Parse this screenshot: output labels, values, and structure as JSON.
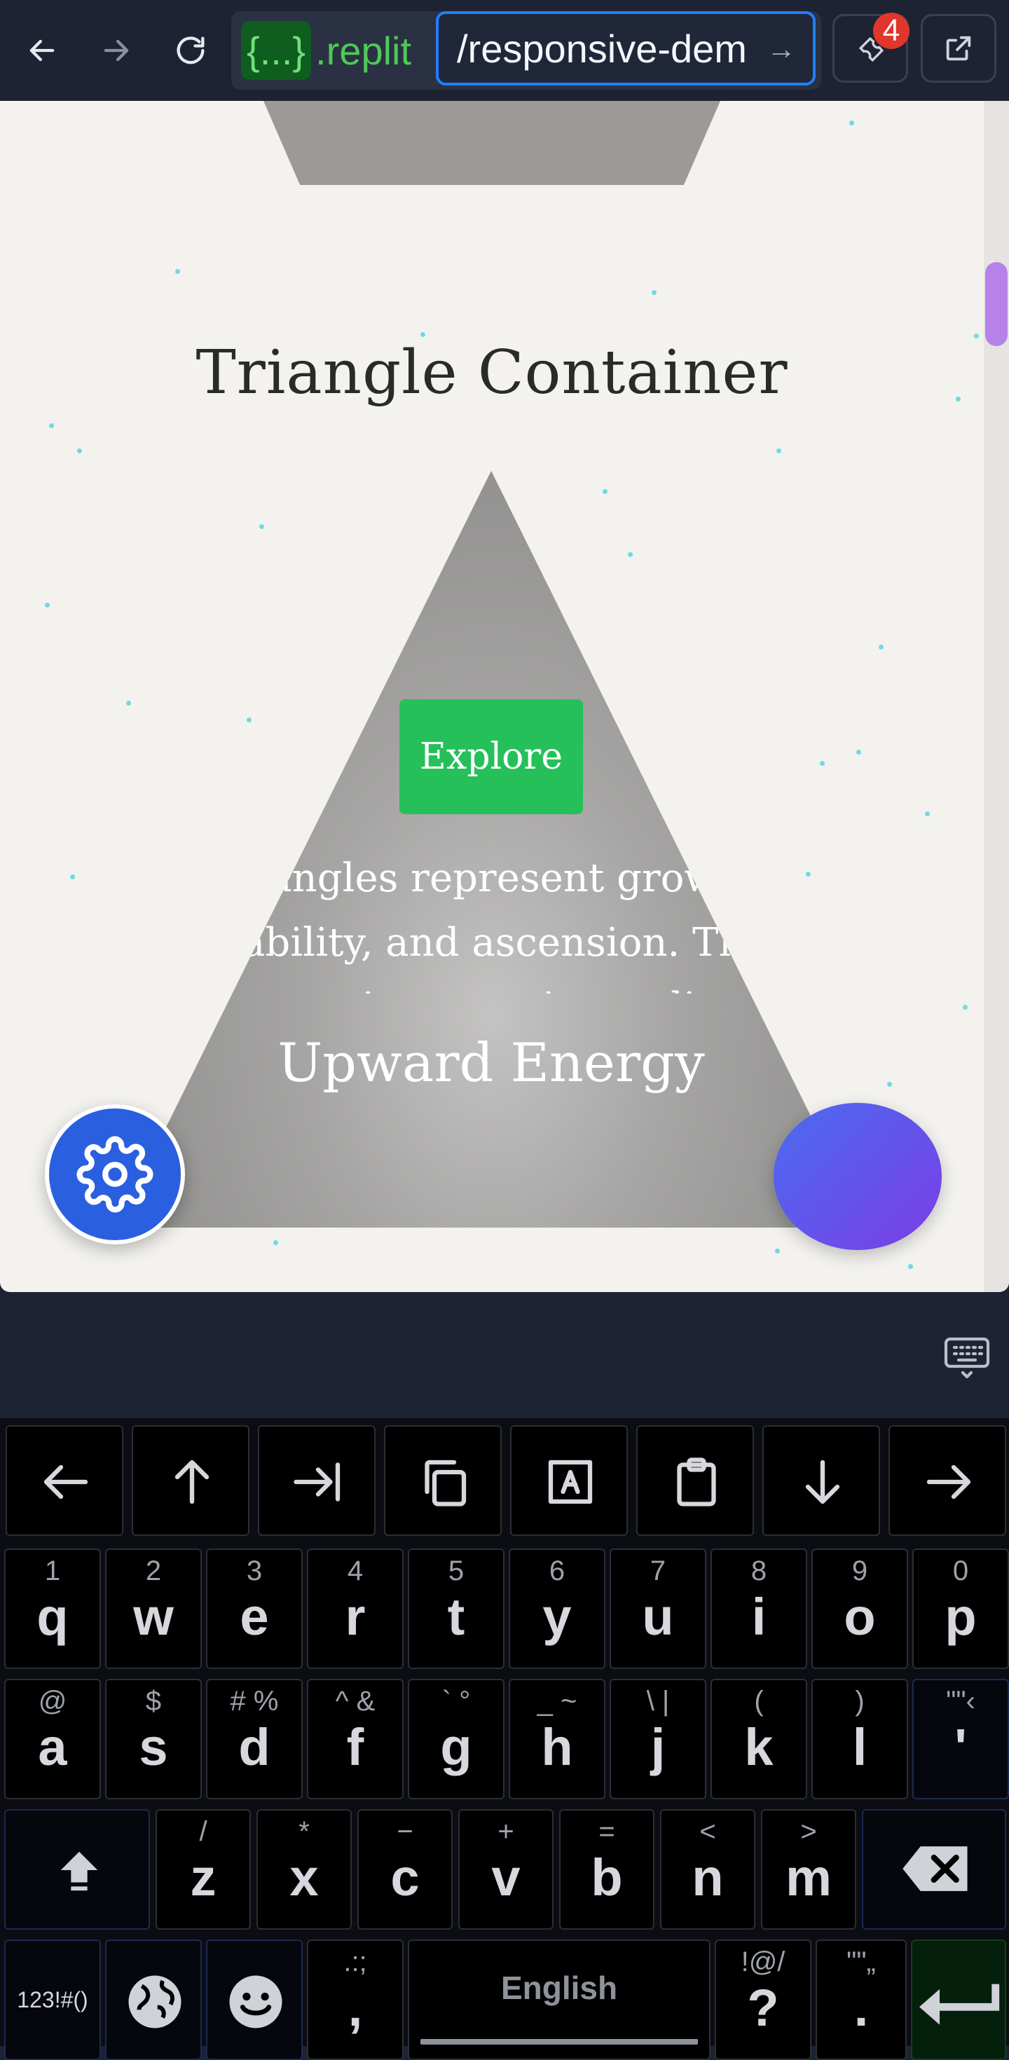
{
  "browser": {
    "url_host": "{...}.replit",
    "url_host_badge": "{...}",
    "url_host_rest": ".replit",
    "url_path": "/responsive-dem",
    "devtools_badge_count": "4",
    "icons": [
      "back-arrow-icon",
      "forward-arrow-icon",
      "reload-icon",
      "go-arrow-icon",
      "wrench-icon",
      "open-new-tab-icon"
    ]
  },
  "page": {
    "section_title": "Triangle Container",
    "explore_label": "Explore",
    "body_text": "Triangles represent growth, stability, and ascension. This responsive container adjusts content to fit",
    "triangle_heading": "Upward Energy",
    "colors": {
      "explore": "#25c05a",
      "settings_fab": "#2a5fe0",
      "action_fab_from": "#4a6cf0",
      "action_fab_to": "#7b3de6",
      "scroll_thumb": "#b682ea"
    }
  },
  "keyboard": {
    "toolbar": [
      "←",
      "↑",
      "⇥",
      "copy",
      "select-all",
      "paste",
      "↓",
      "→"
    ],
    "row1": [
      {
        "main": "q",
        "sub": "1"
      },
      {
        "main": "w",
        "sub": "2"
      },
      {
        "main": "e",
        "sub": "3"
      },
      {
        "main": "r",
        "sub": "4"
      },
      {
        "main": "t",
        "sub": "5"
      },
      {
        "main": "y",
        "sub": "6"
      },
      {
        "main": "u",
        "sub": "7"
      },
      {
        "main": "i",
        "sub": "8"
      },
      {
        "main": "o",
        "sub": "9"
      },
      {
        "main": "p",
        "sub": "0"
      }
    ],
    "row2": [
      {
        "main": "a",
        "sub": "@"
      },
      {
        "main": "s",
        "sub": "$"
      },
      {
        "main": "d",
        "sub": "# %"
      },
      {
        "main": "f",
        "sub": "^ &"
      },
      {
        "main": "g",
        "sub": "` °"
      },
      {
        "main": "h",
        "sub": "_ ~"
      },
      {
        "main": "j",
        "sub": "\\ |"
      },
      {
        "main": "k",
        "sub": "("
      },
      {
        "main": "l",
        "sub": ")"
      },
      {
        "main": "'",
        "sub": "\"\"‹"
      }
    ],
    "row3": [
      {
        "main": "z",
        "sub": "/"
      },
      {
        "main": "x",
        "sub": "*"
      },
      {
        "main": "c",
        "sub": "−"
      },
      {
        "main": "v",
        "sub": "+"
      },
      {
        "main": "b",
        "sub": "="
      },
      {
        "main": "n",
        "sub": "<"
      },
      {
        "main": "m",
        "sub": ">"
      }
    ],
    "symbols_label": "123!#()",
    "comma": {
      "main": ",",
      "sub": ".:;"
    },
    "space_label": "English",
    "question": {
      "main": "?",
      "sub": "!@/"
    },
    "period": {
      "main": ".",
      "sub": "\"\"„"
    }
  }
}
